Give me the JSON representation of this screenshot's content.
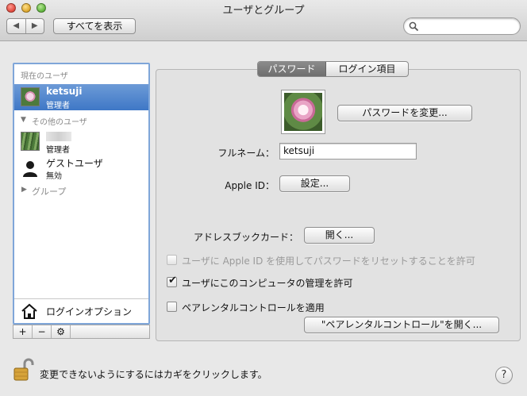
{
  "window": {
    "title": "ユーザとグループ"
  },
  "toolbar": {
    "back": "◀",
    "forward": "▶",
    "show_all_label": "すべてを表示",
    "search_placeholder": ""
  },
  "sidebar": {
    "current_header": "現在のユーザ",
    "current_user": {
      "name": "ketsuji",
      "role": "管理者"
    },
    "other_header": "その他のユーザ",
    "other_users": [
      {
        "name": "",
        "role": "管理者"
      },
      {
        "name": "ゲストユーザ",
        "role": "無効"
      }
    ],
    "group_header": "グループ",
    "login_options": "ログインオプション",
    "tools": [
      "+",
      "−",
      "⚙"
    ]
  },
  "tabs": [
    {
      "label": "パスワード",
      "active": true
    },
    {
      "label": "ログイン項目",
      "active": false
    }
  ],
  "form": {
    "change_password_button": "パスワードを変更...",
    "fullname_label": "フルネーム：",
    "fullname_value": "ketsuji",
    "appleid_label": "Apple ID：",
    "appleid_button": "設定...",
    "addressbook_label": "アドレスブックカード：",
    "addressbook_button": "開く...",
    "checkboxes": [
      {
        "label": "ユーザに Apple ID を使用してパスワードをリセットすることを許可",
        "checked": false,
        "disabled": true
      },
      {
        "label": "ユーザにこのコンピュータの管理を許可",
        "checked": true,
        "disabled": false
      },
      {
        "label": "ペアレンタルコントロールを適用",
        "checked": false,
        "disabled": false
      }
    ],
    "parental_button": "\"ペアレンタルコントロール\"を開く..."
  },
  "footer": {
    "lock_text": "変更できないようにするにはカギをクリックします。",
    "help": "?"
  },
  "colors": {
    "selection": "#3e77c6",
    "focus_ring": "#7fa6d9"
  }
}
